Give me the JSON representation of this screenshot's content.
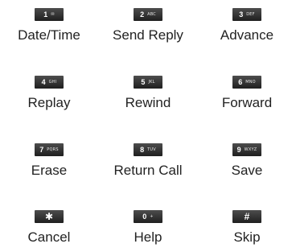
{
  "keys": [
    {
      "digit": "1",
      "letters": "✉",
      "label": "Date/Time"
    },
    {
      "digit": "2",
      "letters": "ABC",
      "label": "Send Reply"
    },
    {
      "digit": "3",
      "letters": "DEF",
      "label": "Advance"
    },
    {
      "digit": "4",
      "letters": "GHI",
      "label": "Replay"
    },
    {
      "digit": "5",
      "letters": "JKL",
      "label": "Rewind"
    },
    {
      "digit": "6",
      "letters": "MNO",
      "label": "Forward"
    },
    {
      "digit": "7",
      "letters": "PQRS",
      "label": "Erase"
    },
    {
      "digit": "8",
      "letters": "TUV",
      "label": "Return Call"
    },
    {
      "digit": "9",
      "letters": "WXYZ",
      "label": "Save"
    },
    {
      "digit": "✱",
      "letters": "",
      "label": "Cancel"
    },
    {
      "digit": "0",
      "letters": "+",
      "label": "Help"
    },
    {
      "digit": "#",
      "letters": "",
      "label": "Skip"
    }
  ]
}
